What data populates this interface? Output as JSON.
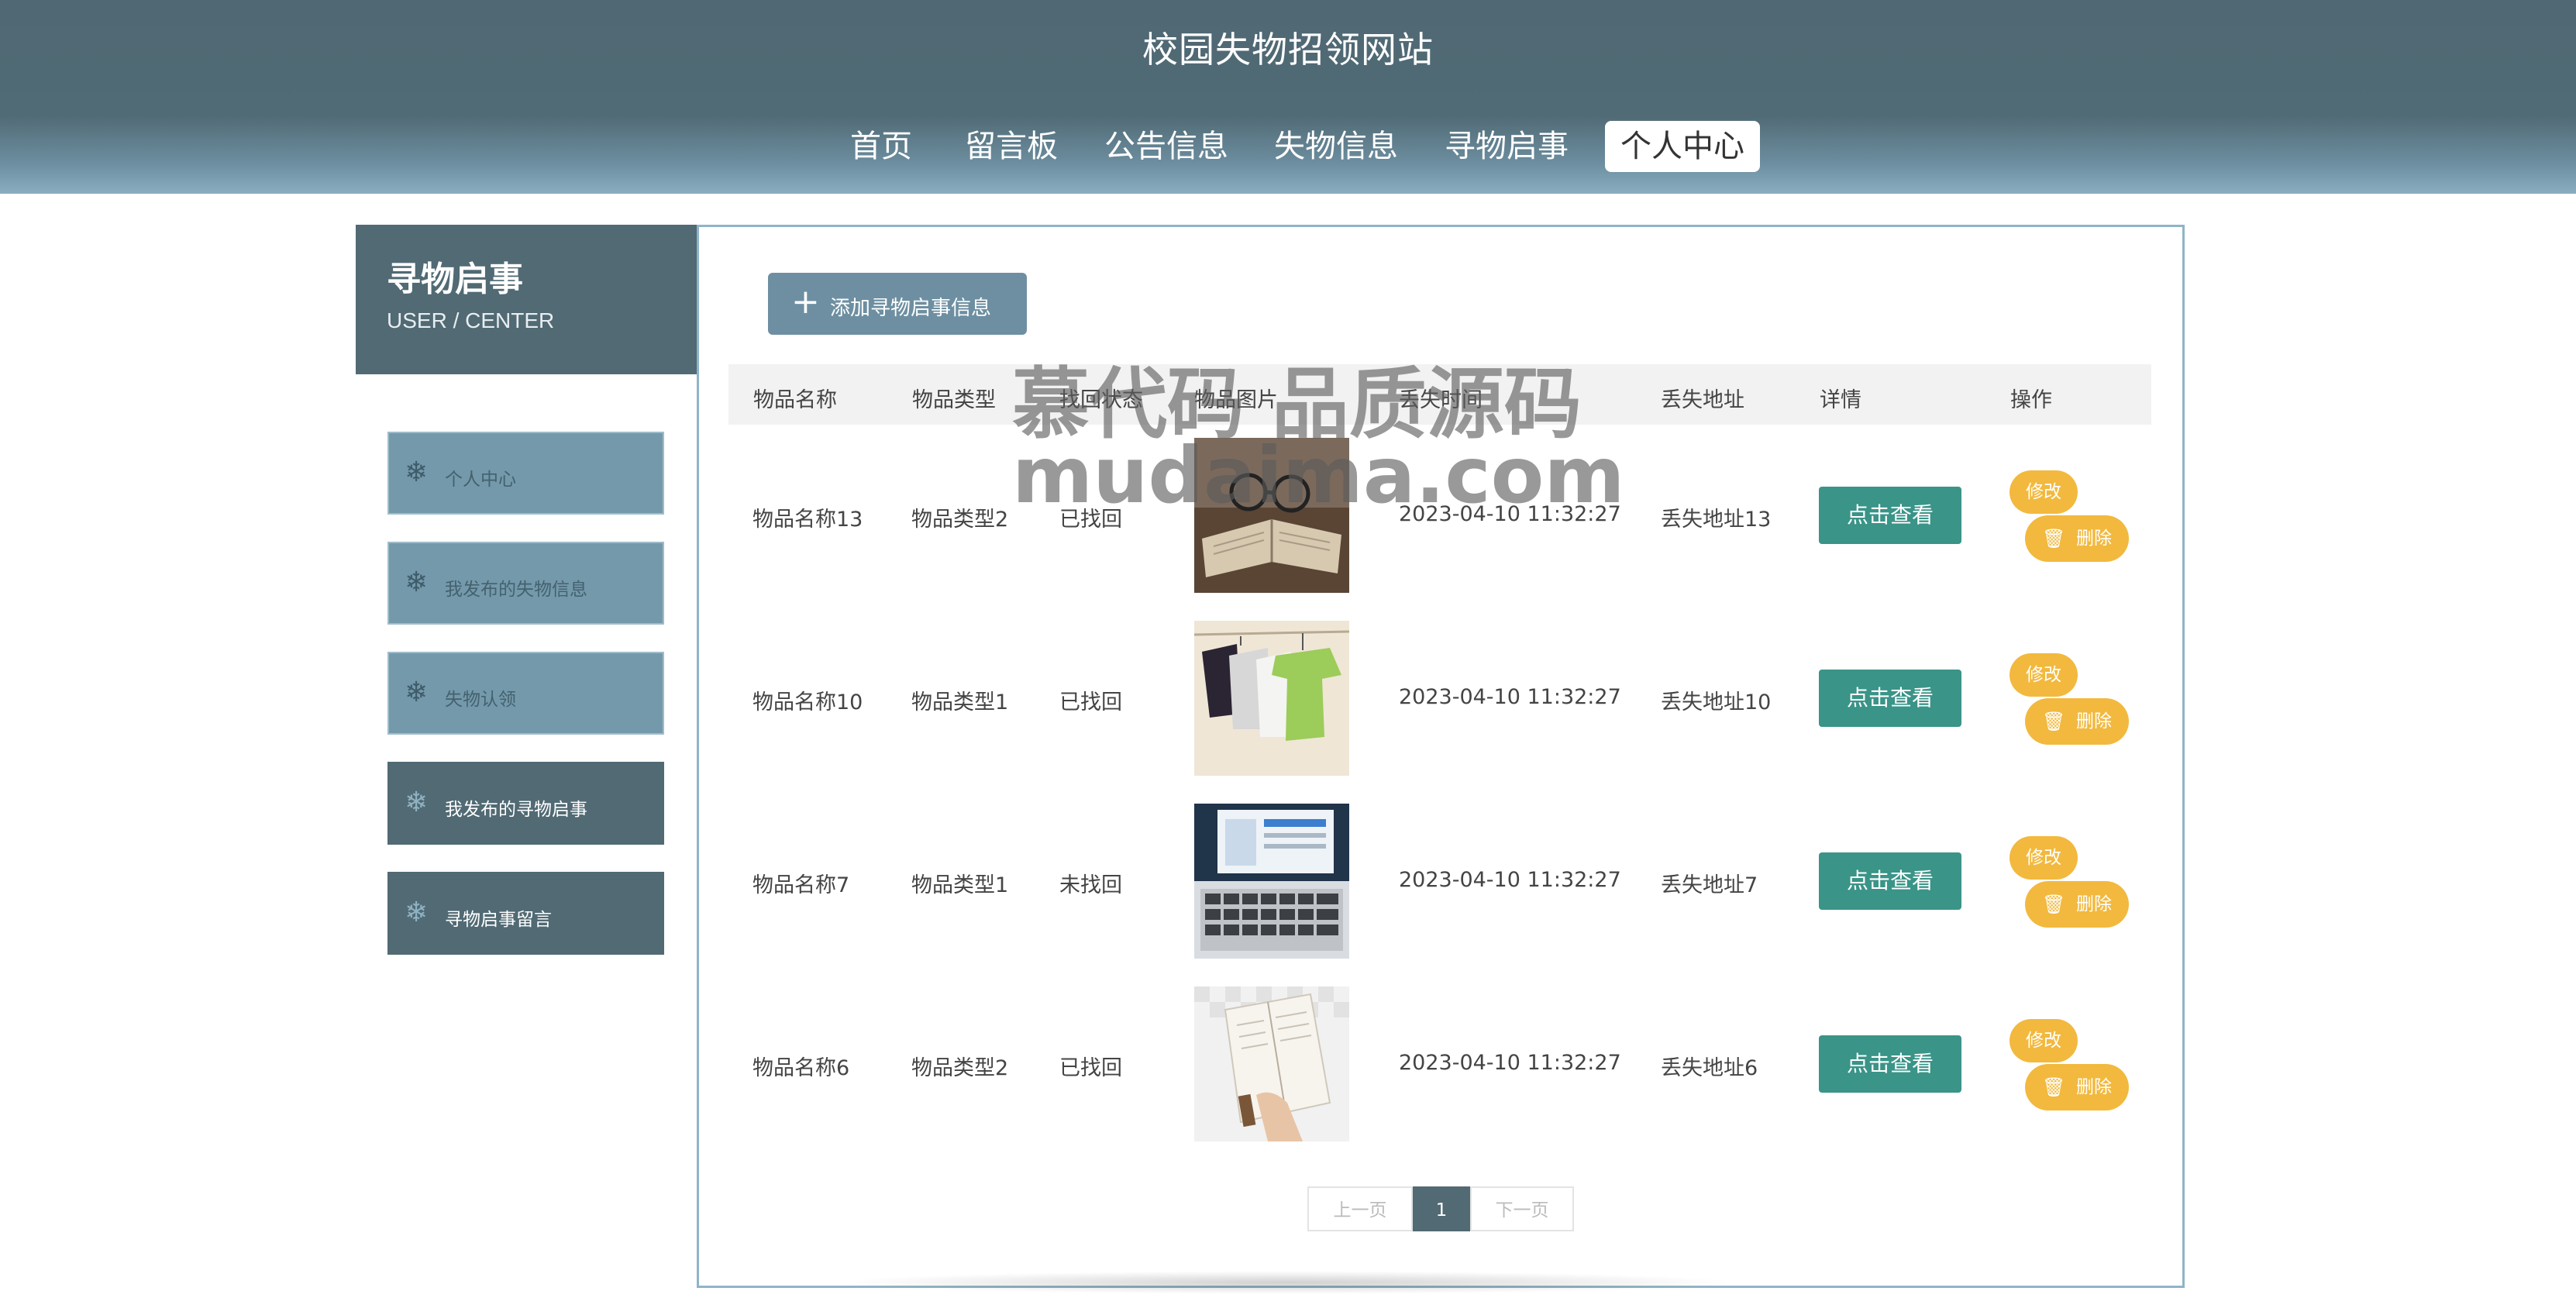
{
  "site": {
    "title": "校园失物招领网站",
    "colors": {
      "header": "#516b76",
      "accent": "#3a9488",
      "warn": "#f2b93e",
      "sidebar_active": "#516a74",
      "sidebar_idle": "#7499ab"
    }
  },
  "nav": {
    "items": [
      "首页",
      "留言板",
      "公告信息",
      "失物信息",
      "寻物启事",
      "个人中心"
    ],
    "active": "个人中心"
  },
  "sidebar": {
    "title": "寻物启事",
    "subtitle": "USER / CENTER",
    "icon": "snowflake-icon",
    "items": [
      {
        "label": "个人中心"
      },
      {
        "label": "我发布的失物信息"
      },
      {
        "label": "失物认领"
      },
      {
        "label": "我发布的寻物启事"
      },
      {
        "label": "寻物启事留言"
      }
    ]
  },
  "toolbar": {
    "add_label": "添加寻物启事信息",
    "add_icon": "plus-icon"
  },
  "table": {
    "headers": [
      "物品名称",
      "物品类型",
      "找回状态",
      "物品图片",
      "丢失时间",
      "丢失地址",
      "详情",
      "操作"
    ],
    "rows": [
      {
        "name": "物品名称13",
        "type": "物品类型2",
        "status": "已找回",
        "image": "open-book-with-glasses",
        "time": "2023-04-10 11:32:27",
        "address": "丢失地址13"
      },
      {
        "name": "物品名称10",
        "type": "物品类型1",
        "status": "已找回",
        "image": "hanging-t-shirts",
        "time": "2023-04-10 11:32:27",
        "address": "丢失地址10"
      },
      {
        "name": "物品名称7",
        "type": "物品类型1",
        "status": "未找回",
        "image": "laptop-keyboard",
        "time": "2023-04-10 11:32:27",
        "address": "丢失地址7"
      },
      {
        "name": "物品名称6",
        "type": "物品类型2",
        "status": "已找回",
        "image": "hand-holding-book",
        "time": "2023-04-10 11:32:27",
        "address": "丢失地址6"
      }
    ],
    "detail_label": "点击查看",
    "edit_label": "修改",
    "delete_label": "删除",
    "delete_icon": "trash-icon"
  },
  "pagination": {
    "prev": "上一页",
    "current": "1",
    "next": "下一页"
  },
  "watermark": {
    "line1": "慕代码 品质源码",
    "line2": "mudaima.com"
  }
}
